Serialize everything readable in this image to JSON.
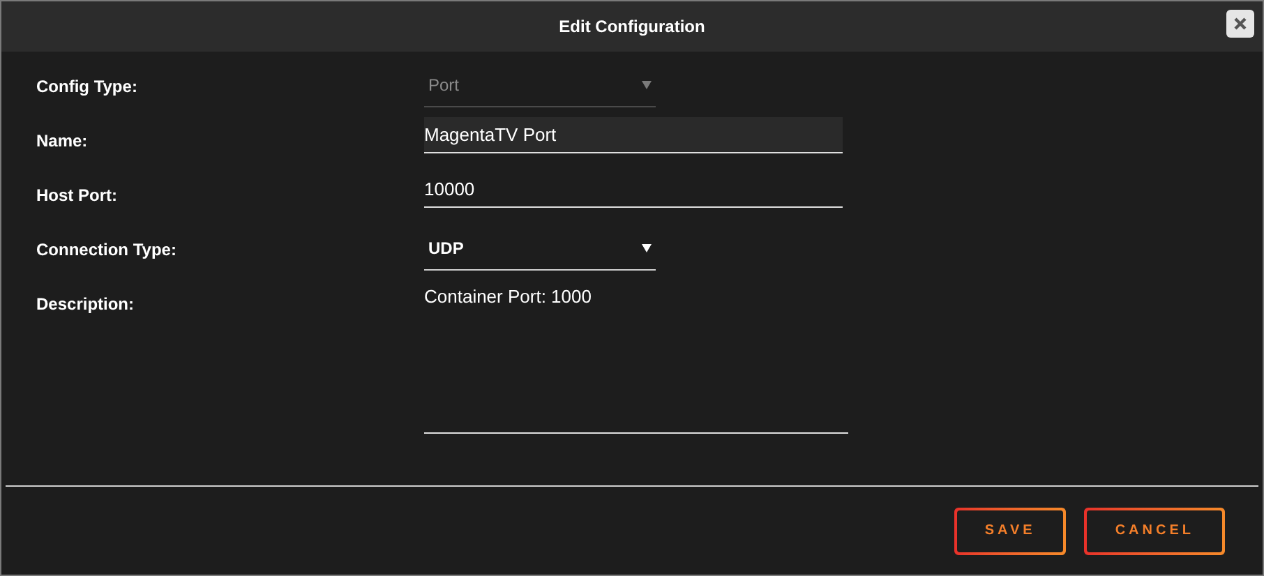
{
  "dialog": {
    "title": "Edit Configuration"
  },
  "fields": [
    {
      "kind": "select",
      "label": "Config Type:",
      "value": "Port",
      "disabled": true
    },
    {
      "kind": "text",
      "label": "Name:",
      "value": "MagentaTV Port",
      "focused": true
    },
    {
      "kind": "text",
      "label": "Host Port:",
      "value": "10000",
      "focused": false
    },
    {
      "kind": "select",
      "label": "Connection Type:",
      "value": "UDP",
      "disabled": false
    },
    {
      "kind": "textarea",
      "label": "Description:",
      "value": "Container Port: 1000"
    }
  ],
  "buttons": [
    {
      "label": "SAVE"
    },
    {
      "label": "CANCEL"
    }
  ]
}
